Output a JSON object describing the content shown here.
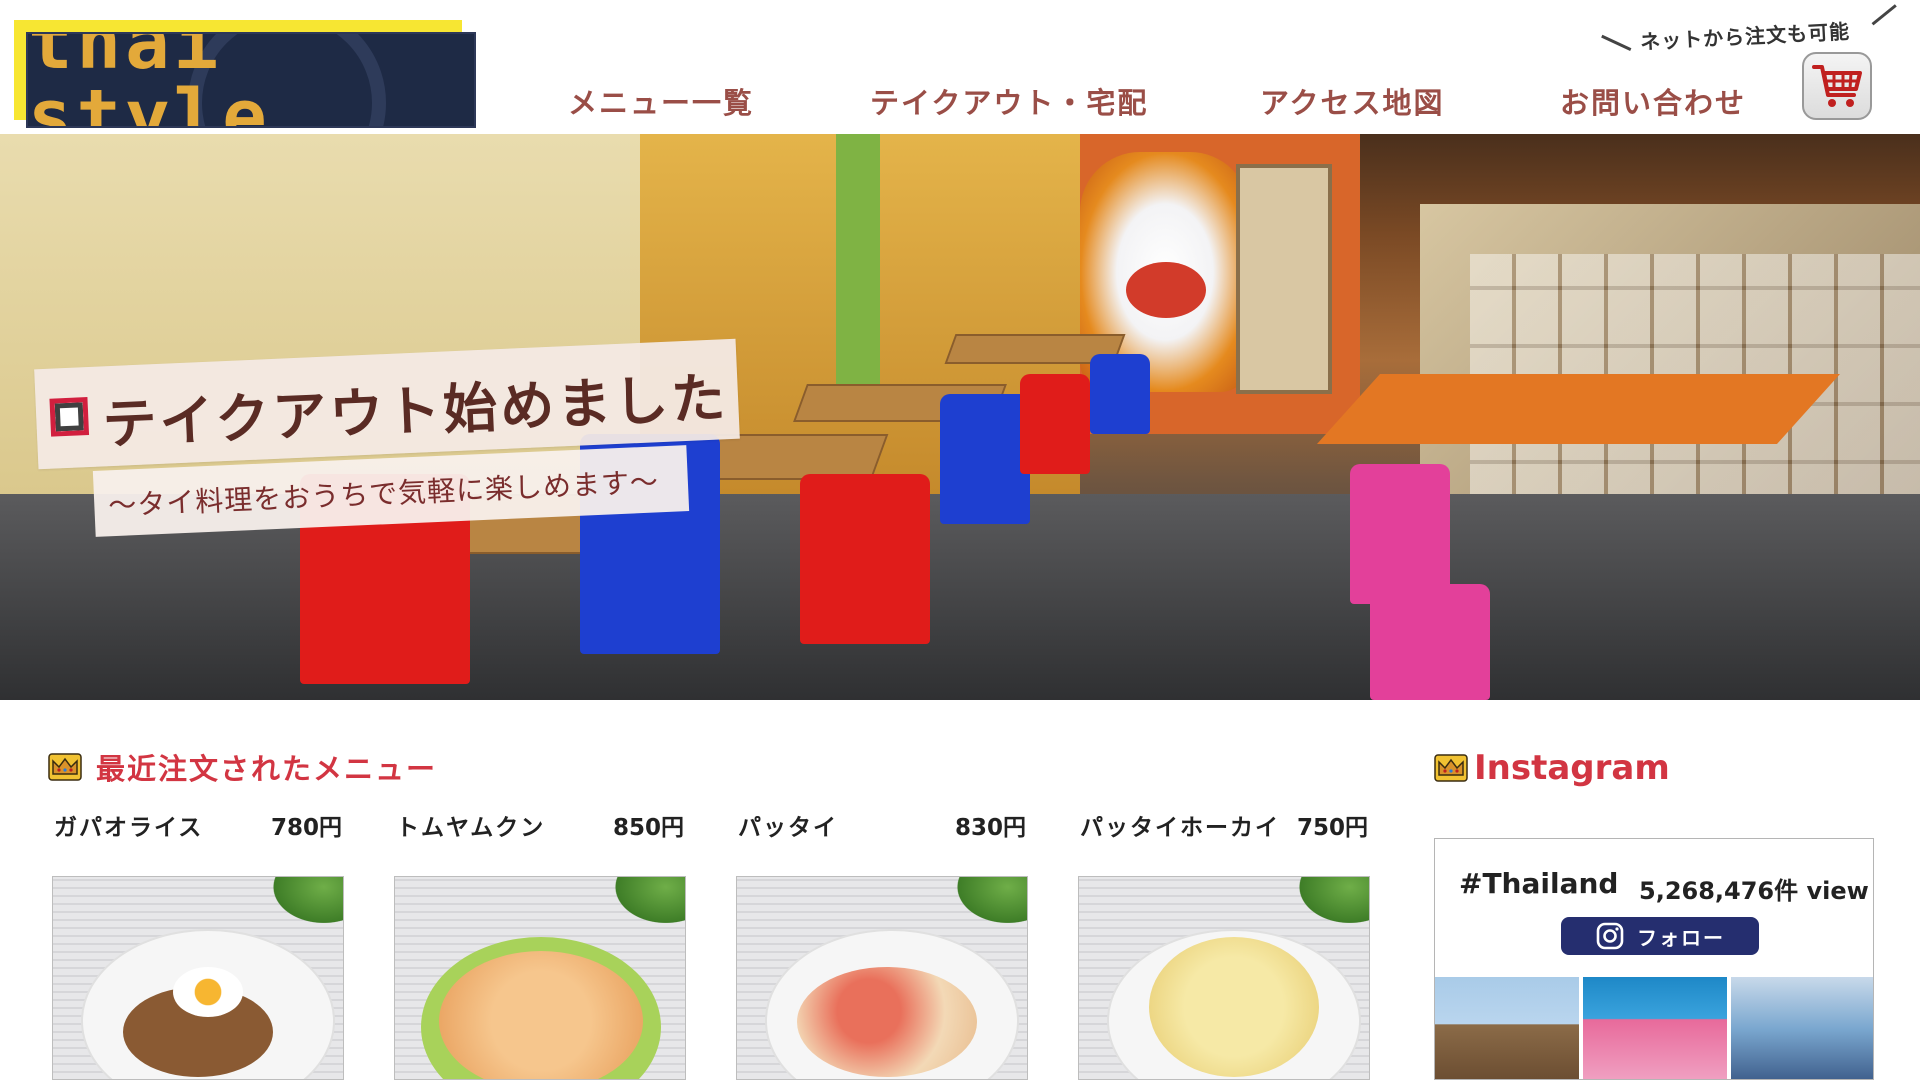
{
  "header": {
    "logo_text": "thai style",
    "nav": [
      {
        "label": "メニュー一覧"
      },
      {
        "label": "テイクアウト・宅配"
      },
      {
        "label": "アクセス地図"
      },
      {
        "label": "お問い合わせ"
      }
    ],
    "order_note": "ネットから注文も可能",
    "cart_icon": "shopping-cart-icon"
  },
  "hero": {
    "headline": "テイクアウト始めました",
    "subline": "～タイ料理をおうちで気軽に楽しめます～"
  },
  "recent_menu": {
    "title": "最近注文されたメニュー",
    "icon": "crown-icon",
    "items": [
      {
        "name": "ガパオライス",
        "price": "780円"
      },
      {
        "name": "トムヤムクン",
        "price": "850円"
      },
      {
        "name": "パッタイ",
        "price": "830円"
      },
      {
        "name": "パッタイホーカイ",
        "price": "750円"
      }
    ]
  },
  "instagram": {
    "title": "Instagram",
    "hashtag": "#Thailand",
    "views": "5,268,476件 view",
    "follow_label": "フォロー",
    "follow_icon": "instagram-icon"
  },
  "colors": {
    "accent_red": "#d23542",
    "nav_brown": "#9a4e47",
    "logo_bg": "#1e2a45",
    "logo_gold": "#e3a93a",
    "logo_yellow": "#f7e632",
    "follow_button": "#252e6f"
  }
}
